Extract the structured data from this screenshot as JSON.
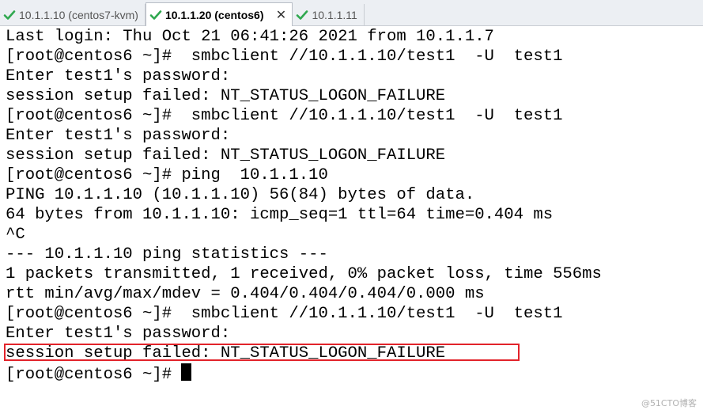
{
  "tabs": [
    {
      "label": "10.1.1.10 (centos7-kvm)",
      "active": false,
      "closable": false
    },
    {
      "label": "10.1.1.20 (centos6)",
      "active": true,
      "closable": true
    },
    {
      "label": "10.1.1.11",
      "active": false,
      "closable": false
    }
  ],
  "tab_close_symbol": "✕",
  "colors": {
    "check": "#2fa84f",
    "highlight": "#e2232a"
  },
  "terminal": {
    "lines": [
      "Last login: Thu Oct 21 06:41:26 2021 from 10.1.1.7",
      "[root@centos6 ~]#  smbclient //10.1.1.10/test1  -U  test1",
      "Enter test1's password:",
      "session setup failed: NT_STATUS_LOGON_FAILURE",
      "[root@centos6 ~]#  smbclient //10.1.1.10/test1  -U  test1",
      "Enter test1's password:",
      "session setup failed: NT_STATUS_LOGON_FAILURE",
      "[root@centos6 ~]# ping  10.1.1.10",
      "PING 10.1.1.10 (10.1.1.10) 56(84) bytes of data.",
      "64 bytes from 10.1.1.10: icmp_seq=1 ttl=64 time=0.404 ms",
      "^C",
      "--- 10.1.1.10 ping statistics ---",
      "1 packets transmitted, 1 received, 0% packet loss, time 556ms",
      "rtt min/avg/max/mdev = 0.404/0.404/0.404/0.000 ms",
      "[root@centos6 ~]#  smbclient //10.1.1.10/test1  -U  test1",
      "Enter test1's password:",
      "session setup failed: NT_STATUS_LOGON_FAILURE"
    ],
    "prompt": "[root@centos6 ~]# "
  },
  "watermark": "@51CTO博客"
}
